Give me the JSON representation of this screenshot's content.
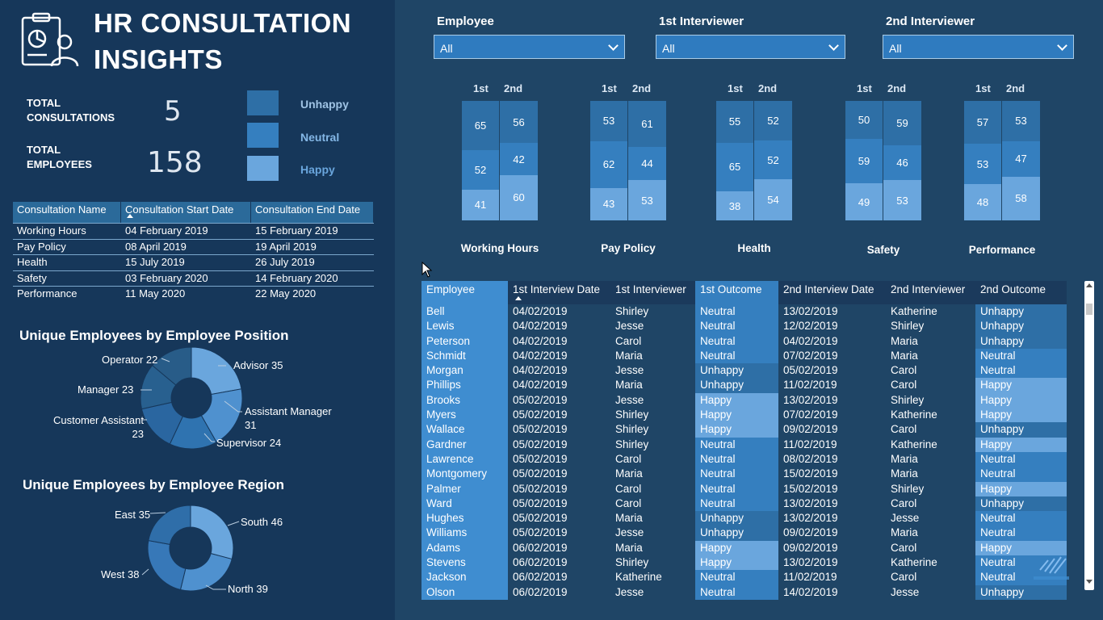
{
  "title": {
    "line1": "HR CONSULTATION",
    "line2": "INSIGHTS"
  },
  "kpis": {
    "consultations_label": "TOTAL\nCONSULTATIONS",
    "consultations_value": "5",
    "employees_label": "TOTAL\nEMPLOYEES",
    "employees_value": "158"
  },
  "legend": [
    {
      "label": "Unhappy",
      "color": "#2e6fa6"
    },
    {
      "label": "Neutral",
      "color": "#357fbf"
    },
    {
      "label": "Happy",
      "color": "#6aa6dd"
    }
  ],
  "consultations": {
    "columns": [
      "Consultation Name",
      "Consultation Start Date",
      "Consultation End Date"
    ],
    "rows": [
      [
        "Working Hours",
        "04 February 2019",
        "15 February 2019"
      ],
      [
        "Pay Policy",
        "08 April 2019",
        "19 April 2019"
      ],
      [
        "Health",
        "15 July 2019",
        "26 July 2019"
      ],
      [
        "Safety",
        "03 February 2020",
        "14 February 2020"
      ],
      [
        "Performance",
        "11 May 2020",
        "22 May 2020"
      ]
    ]
  },
  "position_chart": {
    "title": "Unique Employees by Employee Position",
    "labels": {
      "advisor": "Advisor 35",
      "assistant_manager": "Assistant Manager\n31",
      "supervisor": "Supervisor 24",
      "customer_assistant": "Customer Assistant\n23",
      "manager": "Manager 23",
      "operator": "Operator 22"
    }
  },
  "region_chart": {
    "title": "Unique Employees by Employee Region",
    "labels": {
      "south": "South 46",
      "north": "North 39",
      "west": "West 38",
      "east": "East 35"
    }
  },
  "chart_data": [
    {
      "type": "pie",
      "title": "Unique Employees by Employee Position",
      "categories": [
        "Advisor",
        "Assistant Manager",
        "Supervisor",
        "Customer Assistant",
        "Manager",
        "Operator"
      ],
      "values": [
        35,
        31,
        24,
        23,
        23,
        22
      ],
      "colors": [
        "#6aa6dd",
        "#4f91cf",
        "#2f73b0",
        "#2a66a0",
        "#28608f",
        "#285c88"
      ]
    },
    {
      "type": "pie",
      "title": "Unique Employees by Employee Region",
      "categories": [
        "South",
        "North",
        "West",
        "East"
      ],
      "values": [
        46,
        39,
        38,
        35
      ],
      "colors": [
        "#6aa6dd",
        "#4f91cf",
        "#3778b8",
        "#2f6ea9"
      ]
    },
    {
      "type": "bar",
      "stacked": true,
      "categories": [
        "Working Hours",
        "Pay Policy",
        "Health",
        "Safety",
        "Performance"
      ],
      "series": [
        {
          "name": "Unhappy",
          "first": [
            65,
            53,
            55,
            50,
            57
          ],
          "second": [
            56,
            61,
            52,
            59,
            53
          ]
        },
        {
          "name": "Neutral",
          "first": [
            52,
            62,
            65,
            59,
            53
          ],
          "second": [
            42,
            44,
            52,
            46,
            47
          ]
        },
        {
          "name": "Happy",
          "first": [
            41,
            43,
            38,
            49,
            48
          ],
          "second": [
            60,
            53,
            54,
            53,
            58
          ]
        }
      ],
      "column_labels": [
        "1st",
        "2nd"
      ]
    }
  ],
  "slicers": [
    {
      "label": "Employee",
      "value": "All"
    },
    {
      "label": "1st Interviewer",
      "value": "All"
    },
    {
      "label": "2nd Interviewer",
      "value": "All"
    }
  ],
  "detail": {
    "columns": [
      "Employee",
      "1st Interview Date",
      "1st Interviewer",
      "1st Outcome",
      "2nd Interview Date",
      "2nd Interviewer",
      "2nd Outcome"
    ],
    "rows": [
      [
        "Bell",
        "04/02/2019",
        "Shirley",
        "Neutral",
        "13/02/2019",
        "Katherine",
        "Unhappy"
      ],
      [
        "Lewis",
        "04/02/2019",
        "Jesse",
        "Neutral",
        "12/02/2019",
        "Shirley",
        "Unhappy"
      ],
      [
        "Peterson",
        "04/02/2019",
        "Carol",
        "Neutral",
        "04/02/2019",
        "Maria",
        "Unhappy"
      ],
      [
        "Schmidt",
        "04/02/2019",
        "Maria",
        "Neutral",
        "07/02/2019",
        "Maria",
        "Neutral"
      ],
      [
        "Morgan",
        "04/02/2019",
        "Jesse",
        "Unhappy",
        "05/02/2019",
        "Carol",
        "Neutral"
      ],
      [
        "Phillips",
        "04/02/2019",
        "Maria",
        "Unhappy",
        "11/02/2019",
        "Carol",
        "Happy"
      ],
      [
        "Brooks",
        "05/02/2019",
        "Jesse",
        "Happy",
        "13/02/2019",
        "Shirley",
        "Happy"
      ],
      [
        "Myers",
        "05/02/2019",
        "Shirley",
        "Happy",
        "07/02/2019",
        "Katherine",
        "Happy"
      ],
      [
        "Wallace",
        "05/02/2019",
        "Shirley",
        "Happy",
        "09/02/2019",
        "Carol",
        "Unhappy"
      ],
      [
        "Gardner",
        "05/02/2019",
        "Shirley",
        "Neutral",
        "11/02/2019",
        "Katherine",
        "Happy"
      ],
      [
        "Lawrence",
        "05/02/2019",
        "Carol",
        "Neutral",
        "08/02/2019",
        "Maria",
        "Neutral"
      ],
      [
        "Montgomery",
        "05/02/2019",
        "Maria",
        "Neutral",
        "15/02/2019",
        "Maria",
        "Neutral"
      ],
      [
        "Palmer",
        "05/02/2019",
        "Carol",
        "Neutral",
        "15/02/2019",
        "Shirley",
        "Happy"
      ],
      [
        "Ward",
        "05/02/2019",
        "Carol",
        "Neutral",
        "13/02/2019",
        "Carol",
        "Unhappy"
      ],
      [
        "Hughes",
        "05/02/2019",
        "Maria",
        "Unhappy",
        "13/02/2019",
        "Jesse",
        "Neutral"
      ],
      [
        "Williams",
        "05/02/2019",
        "Jesse",
        "Unhappy",
        "09/02/2019",
        "Maria",
        "Neutral"
      ],
      [
        "Adams",
        "06/02/2019",
        "Maria",
        "Happy",
        "09/02/2019",
        "Carol",
        "Happy"
      ],
      [
        "Stevens",
        "06/02/2019",
        "Shirley",
        "Happy",
        "13/02/2019",
        "Katherine",
        "Neutral"
      ],
      [
        "Jackson",
        "06/02/2019",
        "Katherine",
        "Neutral",
        "11/02/2019",
        "Carol",
        "Neutral"
      ],
      [
        "Olson",
        "06/02/2019",
        "Jesse",
        "Neutral",
        "14/02/2019",
        "Jesse",
        "Unhappy"
      ]
    ]
  }
}
